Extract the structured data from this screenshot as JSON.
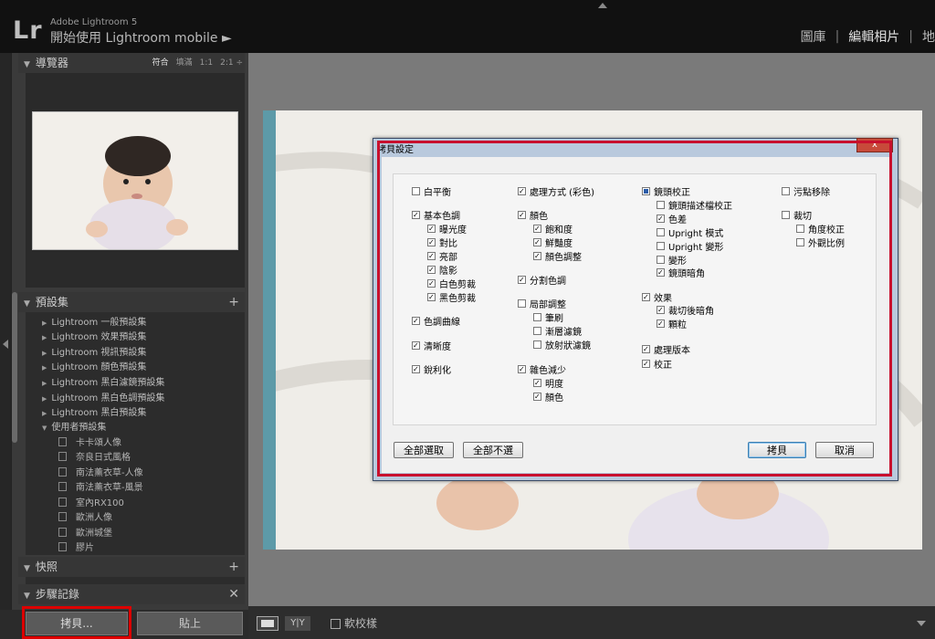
{
  "app": {
    "logo": "Lr",
    "version": "Adobe Lightroom 5",
    "start": "開始使用 Lightroom mobile  ►",
    "modules": [
      "圖庫",
      "編輯相片",
      "地"
    ]
  },
  "navigator": {
    "title": "導覽器",
    "zoom": [
      "符合",
      "填滿",
      "1:1",
      "2:1 ÷"
    ]
  },
  "presets": {
    "title": "預設集",
    "groups": [
      "Lightroom 一般預設集",
      "Lightroom 效果預設集",
      "Lightroom 視訊預設集",
      "Lightroom 顏色預設集",
      "Lightroom 黑白濾鏡預設集",
      "Lightroom 黑白色調預設集",
      "Lightroom 黑白預設集"
    ],
    "user_group": "使用者預設集",
    "user_items": [
      "卡卡頌人像",
      "奈良日式風格",
      "南法薰衣草-人像",
      "南法薰衣草-風景",
      "室內RX100",
      "歐洲人像",
      "歐洲城堡",
      "膠片"
    ]
  },
  "snapshots": {
    "title": "快照"
  },
  "history": {
    "title": "步驟記錄"
  },
  "left_buttons": {
    "copy": "拷貝...",
    "paste": "貼上"
  },
  "toolbar": {
    "yy": "Y|Y",
    "soft_proof": "軟校樣"
  },
  "dialog": {
    "title": "拷貝設定",
    "close": "x",
    "col1": [
      {
        "label": "白平衡",
        "checked": false
      },
      {
        "label": "基本色調",
        "checked": true
      },
      {
        "label": "曝光度",
        "checked": true
      },
      {
        "label": "對比",
        "checked": true
      },
      {
        "label": "亮部",
        "checked": true
      },
      {
        "label": "陰影",
        "checked": true
      },
      {
        "label": "白色剪裁",
        "checked": true
      },
      {
        "label": "黑色剪裁",
        "checked": true
      },
      {
        "label": "色調曲線",
        "checked": true
      },
      {
        "label": "清晰度",
        "checked": true
      },
      {
        "label": "銳利化",
        "checked": true
      }
    ],
    "col2": [
      {
        "label": "處理方式 (彩色)",
        "checked": true
      },
      {
        "label": "顏色",
        "checked": true
      },
      {
        "label": "飽和度",
        "checked": true
      },
      {
        "label": "鮮豔度",
        "checked": true
      },
      {
        "label": "顏色調整",
        "checked": true
      },
      {
        "label": "分割色調",
        "checked": true
      },
      {
        "label": "局部調整",
        "checked": false
      },
      {
        "label": "筆刷",
        "checked": false
      },
      {
        "label": "漸層濾鏡",
        "checked": false
      },
      {
        "label": "放射狀濾鏡",
        "checked": false
      },
      {
        "label": "雜色減少",
        "checked": true
      },
      {
        "label": "明度",
        "checked": true
      },
      {
        "label": "顏色",
        "checked": true
      }
    ],
    "col3": [
      {
        "label": "鏡頭校正",
        "checked": "partial"
      },
      {
        "label": "鏡頭描述檔校正",
        "checked": false
      },
      {
        "label": "色差",
        "checked": true
      },
      {
        "label": "Upright 模式",
        "checked": false
      },
      {
        "label": "Upright 變形",
        "checked": false
      },
      {
        "label": "變形",
        "checked": false
      },
      {
        "label": "鏡頭暗角",
        "checked": true
      },
      {
        "label": "效果",
        "checked": true
      },
      {
        "label": "裁切後暗角",
        "checked": true
      },
      {
        "label": "顆粒",
        "checked": true
      },
      {
        "label": "處理版本",
        "checked": true
      },
      {
        "label": "校正",
        "checked": true
      }
    ],
    "col4": [
      {
        "label": "污點移除",
        "checked": false
      },
      {
        "label": "裁切",
        "checked": false
      },
      {
        "label": "角度校正",
        "checked": false
      },
      {
        "label": "外觀比例",
        "checked": false
      }
    ],
    "buttons": {
      "select_all": "全部選取",
      "select_none": "全部不選",
      "copy": "拷貝",
      "cancel": "取消"
    }
  },
  "colors": {
    "highlight": "#d00000",
    "panel": "#3a3a3a",
    "center": "#7a7a7a"
  }
}
